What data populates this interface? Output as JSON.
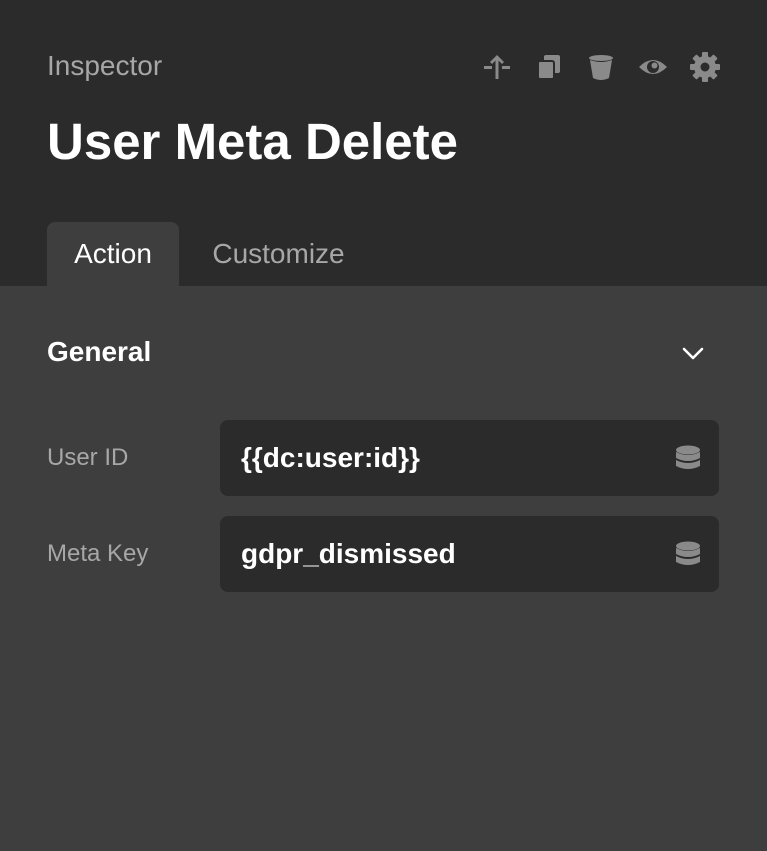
{
  "header": {
    "inspector_label": "Inspector",
    "title": "User Meta Delete",
    "toolbar": [
      {
        "name": "move-up-icon"
      },
      {
        "name": "duplicate-icon"
      },
      {
        "name": "delete-icon"
      },
      {
        "name": "visibility-icon"
      },
      {
        "name": "settings-icon"
      }
    ]
  },
  "tabs": [
    {
      "label": "Action",
      "active": true
    },
    {
      "label": "Customize",
      "active": false
    }
  ],
  "section": {
    "title": "General",
    "expanded": true
  },
  "fields": [
    {
      "label": "User ID",
      "value": "{{dc:user:id}}",
      "icon": "database-icon"
    },
    {
      "label": "Meta Key",
      "value": "gdpr_dismissed",
      "icon": "database-icon"
    }
  ],
  "colors": {
    "header_bg": "#2b2b2b",
    "panel_bg": "#3e3e3e",
    "input_bg": "#2b2b2b",
    "muted_text": "#a7a7a7",
    "icon_gray": "#8a8a8a",
    "text": "#ffffff"
  }
}
